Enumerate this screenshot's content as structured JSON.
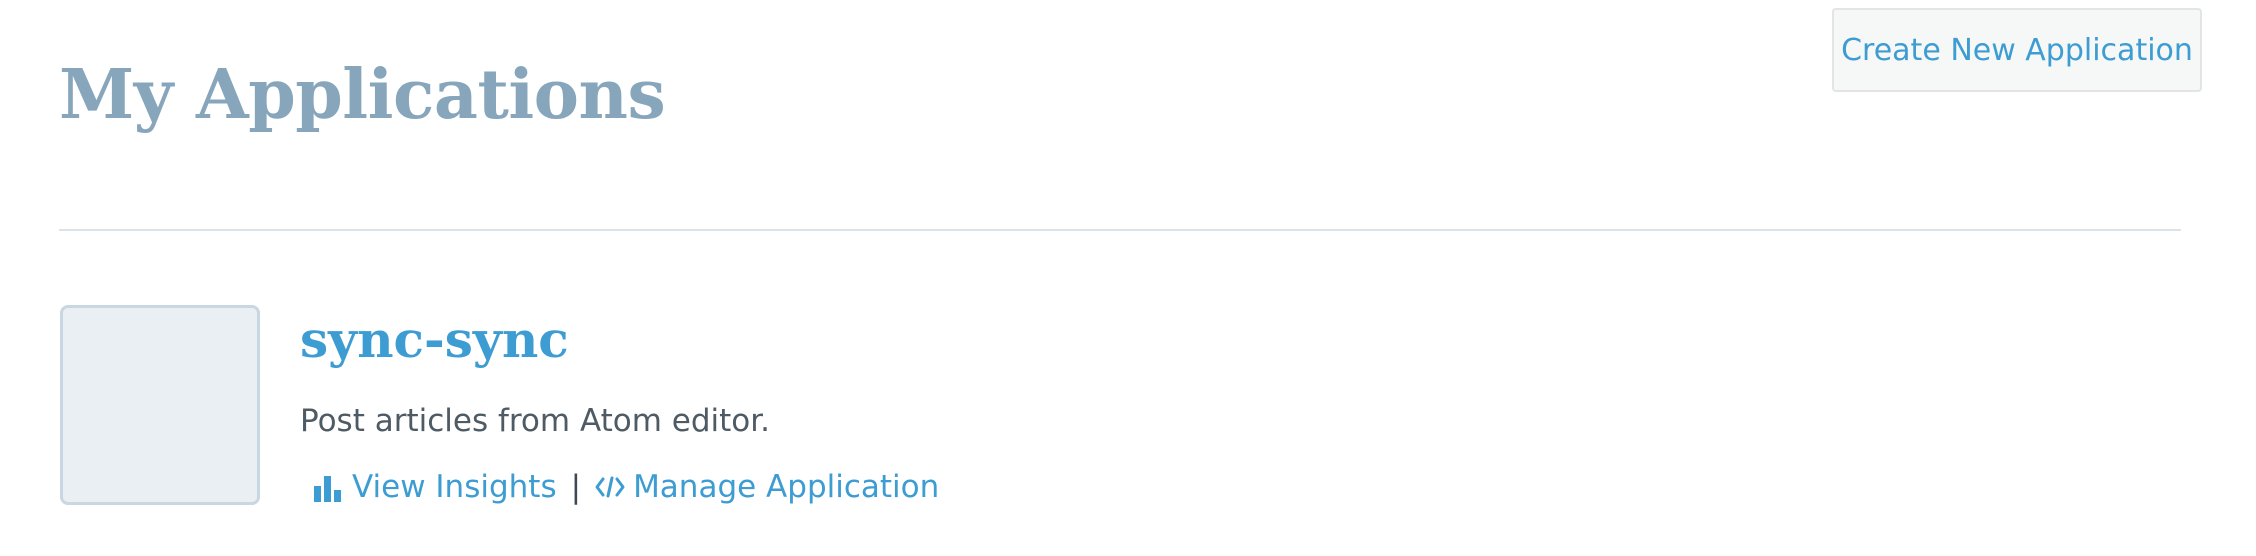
{
  "header": {
    "title": "My Applications",
    "create_button_label": "Create New Application"
  },
  "applications": [
    {
      "name": "sync-sync",
      "description": "Post articles from Atom editor.",
      "actions": {
        "insights_label": "View Insights",
        "insights_icon": "bar-chart-icon",
        "separator": "|",
        "manage_label": "Manage Application",
        "manage_icon": "code-icon"
      }
    }
  ],
  "colors": {
    "title": "#87a6bc",
    "link": "#3d9cd2",
    "text": "#4f5b64",
    "icon_placeholder_bg": "#e9eff3",
    "icon_placeholder_border": "#c8d7e1",
    "divider": "#dce3e8",
    "button_bg": "#f6f7f7"
  }
}
